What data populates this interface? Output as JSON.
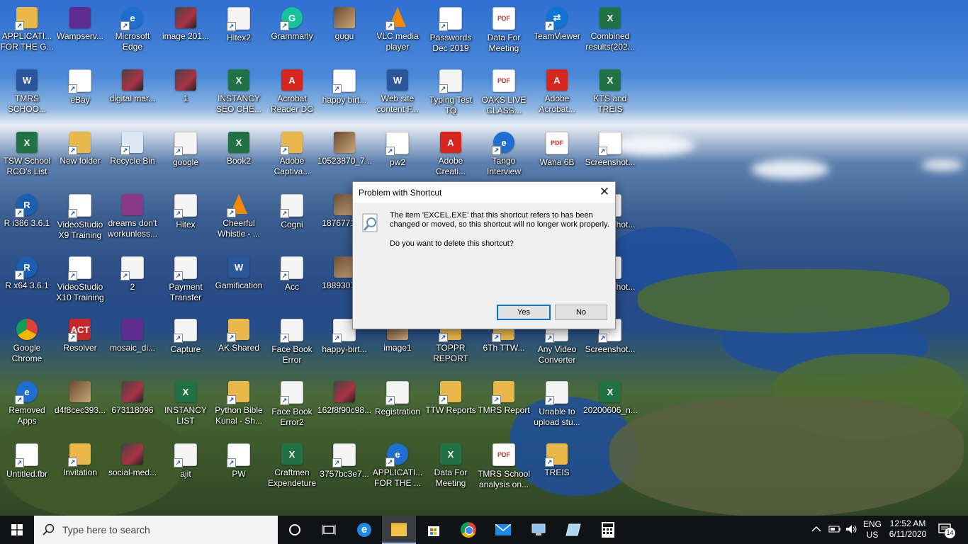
{
  "desktop": {
    "icons": [
      {
        "label": "APPLICATI...\nFOR THE G...",
        "kind": "folder"
      },
      {
        "label": "Wampserv...",
        "kind": "wamp"
      },
      {
        "label": "Microsoft\nEdge",
        "kind": "edge"
      },
      {
        "label": "image 201...",
        "kind": "img"
      },
      {
        "label": "Hitex2",
        "kind": "light"
      },
      {
        "label": "Grammarly",
        "kind": "green"
      },
      {
        "label": "gugu",
        "kind": "photo"
      },
      {
        "label": "VLC media\nplayer",
        "kind": "vlc"
      },
      {
        "label": "Passwords\nDec 2019",
        "kind": "doc"
      },
      {
        "label": "Data For\nMeeting",
        "kind": "pdf"
      },
      {
        "label": "TeamViewer",
        "kind": "tv"
      },
      {
        "label": "Combined\nresults(202...",
        "kind": "excel"
      },
      {
        "label": "TMRS\nSCHOO...",
        "kind": "word"
      },
      {
        "label": "eBay",
        "kind": "doc"
      },
      {
        "label": "digital mar...",
        "kind": "img"
      },
      {
        "label": "1",
        "kind": "img"
      },
      {
        "label": "INSTANCY\nSEO CHE...",
        "kind": "excel"
      },
      {
        "label": "Acrobat\nReader DC",
        "kind": "adobe"
      },
      {
        "label": "happy birt...",
        "kind": "doc"
      },
      {
        "label": "Web site\ncontent F...",
        "kind": "word"
      },
      {
        "label": "Typing Test\nTQ",
        "kind": "light"
      },
      {
        "label": "OAKS LIVE\nCLASS...",
        "kind": "pdf"
      },
      {
        "label": "Adobe\nAcrobat...",
        "kind": "adobe"
      },
      {
        "label": "KTS and\nTREIS",
        "kind": "excel"
      },
      {
        "label": "TSW School\nRCO's List",
        "kind": "excel"
      },
      {
        "label": "New folder",
        "kind": "folder"
      },
      {
        "label": "Recycle Bin",
        "kind": "bin"
      },
      {
        "label": "google",
        "kind": "light"
      },
      {
        "label": "Book2",
        "kind": "excel"
      },
      {
        "label": "Adobe\nCaptiva...",
        "kind": "folder"
      },
      {
        "label": "10523870_7...",
        "kind": "photo"
      },
      {
        "label": "pw2",
        "kind": "doc"
      },
      {
        "label": "Adobe\nCreati...",
        "kind": "adobe"
      },
      {
        "label": "Tango\nInterview",
        "kind": "edge"
      },
      {
        "label": "Wana 6B",
        "kind": "pdf"
      },
      {
        "label": "Screenshot...",
        "kind": "doc"
      },
      {
        "label": "R i386 3.6.1",
        "kind": "r"
      },
      {
        "label": "VideoStudio\nX9 Training",
        "kind": "doc"
      },
      {
        "label": "dreams don't\nworkunless...",
        "kind": "rar"
      },
      {
        "label": "Hitex",
        "kind": "light"
      },
      {
        "label": "Cheerful\nWhistle - ...",
        "kind": "vlc"
      },
      {
        "label": "Cogni",
        "kind": "light"
      },
      {
        "label": "18767719...",
        "kind": "photo"
      },
      {
        "label": "Screenshot...",
        "kind": "doc"
      },
      {
        "label": "R x64 3.6.1",
        "kind": "r"
      },
      {
        "label": "VideoStudio\nX10 Training",
        "kind": "doc"
      },
      {
        "label": "2",
        "kind": "light"
      },
      {
        "label": "Payment\nTransfer",
        "kind": "light"
      },
      {
        "label": "Gamification",
        "kind": "word"
      },
      {
        "label": "Acc",
        "kind": "light"
      },
      {
        "label": "18893076...",
        "kind": "photo"
      },
      {
        "label": "Screenshot...",
        "kind": "doc"
      },
      {
        "label": "Google\nChrome",
        "kind": "chrome"
      },
      {
        "label": "Resolver",
        "kind": "act"
      },
      {
        "label": "mosaic_di...",
        "kind": "purple"
      },
      {
        "label": "Capture",
        "kind": "light"
      },
      {
        "label": "AK Shared",
        "kind": "folder"
      },
      {
        "label": "Face Book\nError",
        "kind": "light"
      },
      {
        "label": "happy-birt...",
        "kind": "light"
      },
      {
        "label": "image1",
        "kind": "photo"
      },
      {
        "label": "TOPPR\nREPORT",
        "kind": "folder"
      },
      {
        "label": "6Th TTW...",
        "kind": "folder"
      },
      {
        "label": "Any Video\nConverter",
        "kind": "light"
      },
      {
        "label": "Screenshot...",
        "kind": "doc"
      },
      {
        "label": "Removed\nApps",
        "kind": "edge"
      },
      {
        "label": "d4f8cec393...",
        "kind": "photo"
      },
      {
        "label": "673118096",
        "kind": "img"
      },
      {
        "label": "INSTANCY\nLIST",
        "kind": "excel"
      },
      {
        "label": "Python Bible\nKunal - Sh...",
        "kind": "folder"
      },
      {
        "label": "Face Book\nError2",
        "kind": "light"
      },
      {
        "label": "162f8f90c98...",
        "kind": "img"
      },
      {
        "label": "Registration",
        "kind": "light"
      },
      {
        "label": "TTW Reports",
        "kind": "folder"
      },
      {
        "label": "TMRS Report",
        "kind": "folder"
      },
      {
        "label": "Unable to\nupload stu...",
        "kind": "light"
      },
      {
        "label": "20200606_n...",
        "kind": "excel"
      },
      {
        "label": "Untitled.fbr",
        "kind": "doc"
      },
      {
        "label": "Invitation",
        "kind": "folder"
      },
      {
        "label": "social-med...",
        "kind": "img"
      },
      {
        "label": "ajit",
        "kind": "light"
      },
      {
        "label": "PW",
        "kind": "doc"
      },
      {
        "label": "Craftmen\nExpendeture",
        "kind": "excel"
      },
      {
        "label": "3757bc3e7...",
        "kind": "light"
      },
      {
        "label": "APPLICATI...\nFOR THE ...",
        "kind": "edge"
      },
      {
        "label": "Data For\nMeeting",
        "kind": "excel"
      },
      {
        "label": "TMRS School\nanalysis on...",
        "kind": "pdf"
      },
      {
        "label": "TREIS",
        "kind": "folder"
      }
    ]
  },
  "dialog": {
    "title": "Problem with Shortcut",
    "close": "✕",
    "message": "The item 'EXCEL.EXE' that this shortcut refers to has been\nchanged or moved, so this shortcut will no longer work properly.",
    "question": "Do you want to delete this shortcut?",
    "yes": "Yes",
    "no": "No"
  },
  "taskbar": {
    "search_placeholder": "Type here to search",
    "lang_top": "ENG",
    "lang_bottom": "US",
    "time": "12:52 AM",
    "date": "6/11/2020",
    "notification_count": "14"
  }
}
